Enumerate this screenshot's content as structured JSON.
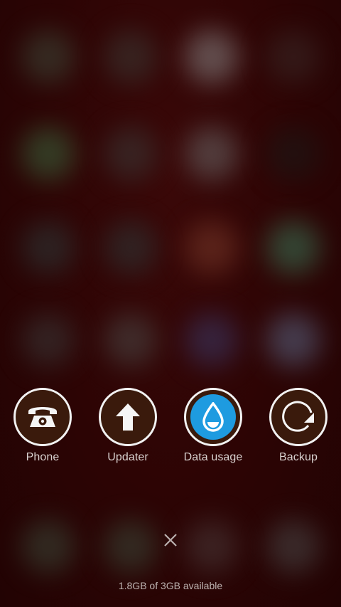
{
  "quick_actions": [
    {
      "label": "Phone",
      "icon": "phone-icon"
    },
    {
      "label": "Updater",
      "icon": "arrow-up-icon"
    },
    {
      "label": "Data usage",
      "icon": "water-drop-icon"
    },
    {
      "label": "Backup",
      "icon": "backup-icon"
    }
  ],
  "close": {
    "icon": "close-icon"
  },
  "memory": {
    "text": "1.8GB of 3GB available"
  },
  "colors": {
    "background": "#2c0404",
    "accent_blue": "#1e9be0",
    "ring": "#f2f2f2",
    "icon_fill": "#3a1a0c"
  }
}
